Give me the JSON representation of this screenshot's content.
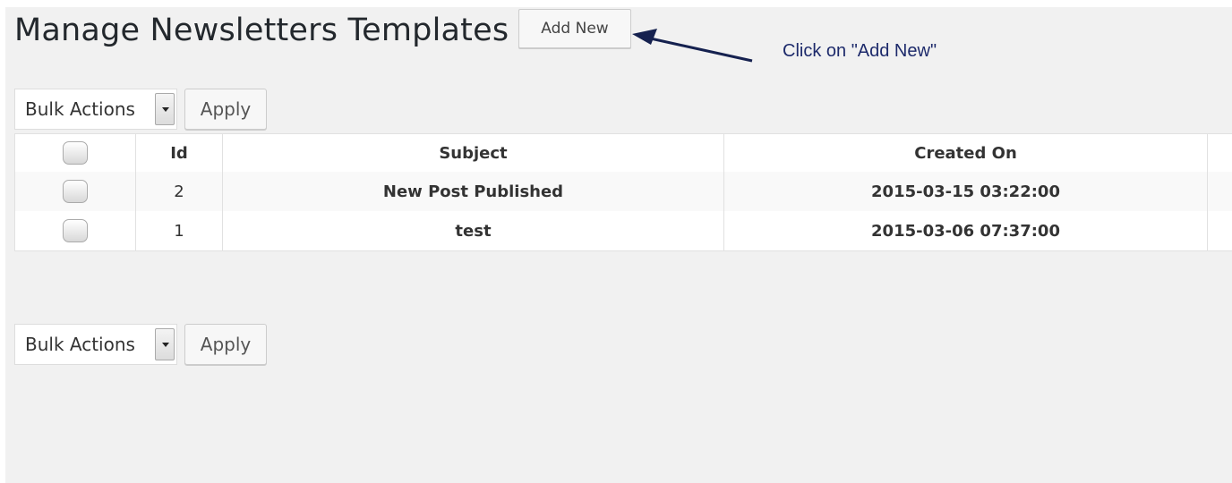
{
  "page": {
    "title": "Manage Newsletters Templates",
    "add_new_label": "Add New"
  },
  "annotation": {
    "text": "Click on \"Add New\"",
    "color": "#1d2a6b"
  },
  "bulk_top": {
    "select_value": "Bulk Actions",
    "apply_label": "Apply"
  },
  "bulk_bottom": {
    "select_value": "Bulk Actions",
    "apply_label": "Apply"
  },
  "table": {
    "headers": {
      "id": "Id",
      "subject": "Subject",
      "created_on": "Created On"
    },
    "rows": [
      {
        "id": "2",
        "subject": "New Post Published",
        "created_on": "2015-03-15 03:22:00"
      },
      {
        "id": "1",
        "subject": "test",
        "created_on": "2015-03-06 07:37:00"
      }
    ]
  },
  "icons": {
    "row_checkbox": "checkbox-icon",
    "select_arrow": "caret-down-icon",
    "annotation_arrow": "arrow-left-icon"
  }
}
